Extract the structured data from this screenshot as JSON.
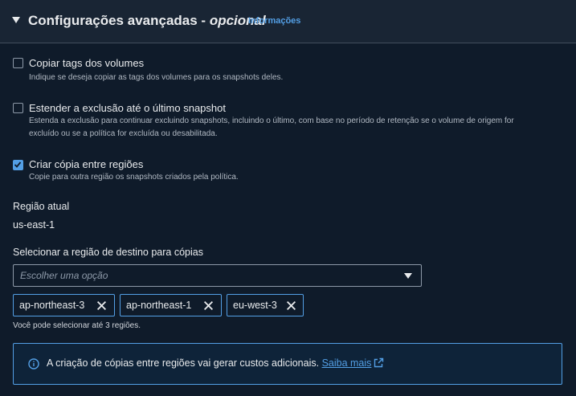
{
  "header": {
    "title": "Configurações avançadas",
    "separator": " - ",
    "optional": "opcional",
    "info_link": "Informações"
  },
  "options": [
    {
      "label": "Copiar tags dos volumes",
      "description": "Indique se deseja copiar as tags dos volumes para os snapshots deles.",
      "checked": false
    },
    {
      "label": "Estender a exclusão até o último snapshot",
      "description_line1": "Estenda a exclusão para continuar excluindo snapshots, incluindo o último, com base no período de retenção se o volume de origem for",
      "description_line2": "excluído ou se a política for excluída ou desabilitada.",
      "checked": false
    },
    {
      "label": "Criar cópia entre regiões",
      "description": "Copie para outra região os snapshots criados pela política.",
      "checked": true
    }
  ],
  "current_region": {
    "label": "Região atual",
    "value": "us-east-1"
  },
  "destination": {
    "label": "Selecionar a região de destino para cópias",
    "placeholder": "Escolher uma opção",
    "tokens": [
      "ap-northeast-3",
      "ap-northeast-1",
      "eu-west-3"
    ],
    "hint": "Você pode selecionar até 3 regiões."
  },
  "alert": {
    "text": "A criação de cópias entre regiões vai gerar custos adicionais. ",
    "link": "Saiba mais"
  },
  "colors": {
    "accent": "#539fe5",
    "background": "#0f1b2a",
    "header_bg": "#192534"
  }
}
